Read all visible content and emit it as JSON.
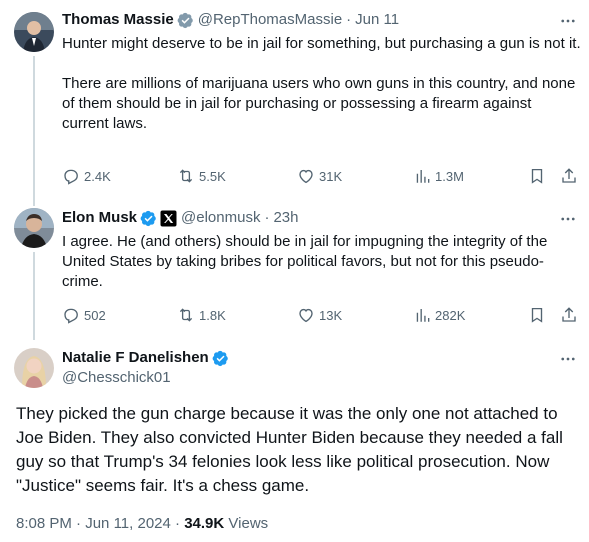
{
  "tweets": [
    {
      "name": "Thomas Massie",
      "handle": "@RepThomasMassie",
      "time": "Jun 11",
      "text": "Hunter might deserve to be in jail for something, but purchasing a gun is not it.\n\nThere are millions of marijuana users who own guns in this country, and none of them should be in jail for purchasing or possessing a firearm against current laws.",
      "replies": "2.4K",
      "reposts": "5.5K",
      "likes": "31K",
      "views": "1.3M"
    },
    {
      "name": "Elon Musk",
      "handle": "@elonmusk",
      "time": "23h",
      "text": "I agree. He (and others) should be in jail for impugning the integrity of the United States by taking bribes for political favors, but not for this pseudo-crime.",
      "replies": "502",
      "reposts": "1.8K",
      "likes": "13K",
      "views": "282K"
    }
  ],
  "main": {
    "name": "Natalie F Danelishen",
    "handle": "@Chesschick01",
    "text": "They picked the gun charge because it was the only one not attached to Joe Biden. They also convicted Hunter Biden because they needed a fall guy so that Trump's 34 felonies look less like political prosecution. Now \"Justice\" seems fair. It's a chess game.",
    "time": "8:08 PM",
    "date": "Jun 11, 2024",
    "views_count": "34.9K",
    "views_label": "Views"
  },
  "dot": "·",
  "colors": {
    "verified": "#1d9bf0",
    "muted": "#536471",
    "line": "#cfd9de"
  }
}
